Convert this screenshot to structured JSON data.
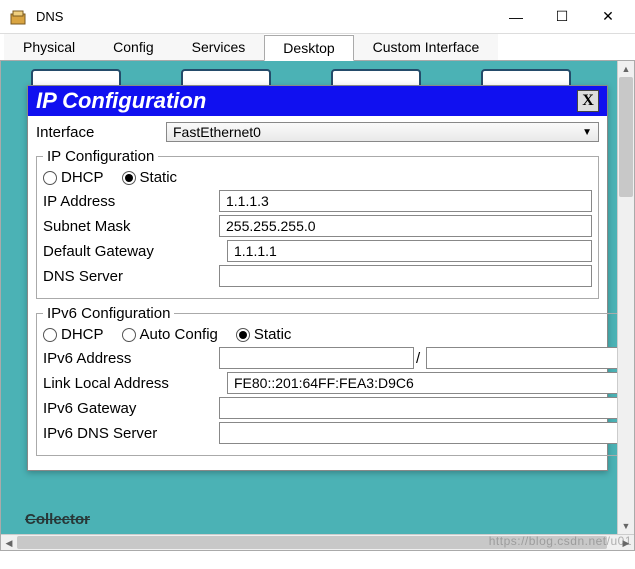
{
  "window": {
    "title": "DNS",
    "controls": {
      "min": "—",
      "max": "☐",
      "close": "✕"
    }
  },
  "tabs": {
    "items": [
      "Physical",
      "Config",
      "Services",
      "Desktop",
      "Custom Interface"
    ],
    "active_index": 3
  },
  "modal": {
    "title": "IP Configuration",
    "close": "X",
    "interface_label": "Interface",
    "interface_value": "FastEthernet0"
  },
  "ipconfig": {
    "legend": "IP Configuration",
    "dhcp_label": "DHCP",
    "static_label": "Static",
    "selected": "static",
    "fields": {
      "ip_label": "IP Address",
      "ip_value": "1.1.1.3",
      "mask_label": "Subnet Mask",
      "mask_value": "255.255.255.0",
      "gw_label": "Default Gateway",
      "gw_value": "1.1.1.1",
      "dns_label": "DNS Server",
      "dns_value": ""
    }
  },
  "ipv6": {
    "legend": "IPv6 Configuration",
    "dhcp_label": "DHCP",
    "auto_label": "Auto Config",
    "static_label": "Static",
    "selected": "static",
    "fields": {
      "addr_label": "IPv6 Address",
      "addr_value": "",
      "prefix_value": "",
      "lla_label": "Link Local Address",
      "lla_value": "FE80::201:64FF:FEA3:D9C6",
      "gw_label": "IPv6 Gateway",
      "gw_value": "",
      "dns_label": "IPv6 DNS Server",
      "dns_value": ""
    }
  },
  "bg_text": "Collector",
  "watermark": "https://blog.csdn.net/u01"
}
